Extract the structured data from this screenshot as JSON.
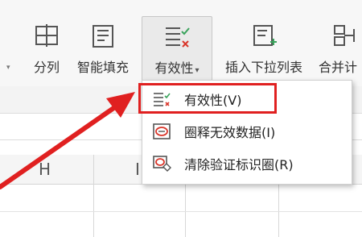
{
  "ribbon": {
    "buttons": [
      {
        "label": "分列",
        "icon": "split-columns-icon"
      },
      {
        "label": "智能填充",
        "icon": "smart-fill-icon"
      },
      {
        "label": "有效性",
        "icon": "data-validation-icon",
        "dropdown_arrow": "▾"
      },
      {
        "label": "插入下拉列表",
        "icon": "insert-dropdown-list-icon"
      },
      {
        "label": "合并计",
        "icon": "merge-calc-icon"
      }
    ],
    "tick": "▾"
  },
  "sheet": {
    "columns": [
      "H",
      "I"
    ]
  },
  "menu": {
    "items": [
      {
        "label": "有效性(V)",
        "icon": "validation-list-icon"
      },
      {
        "label": "圈释无效数据(I)",
        "icon": "circle-invalid-icon"
      },
      {
        "label": "清除验证标识圈(R)",
        "icon": "clear-circle-icon"
      }
    ]
  },
  "colors": {
    "highlight": "#e02020",
    "icon_green": "#3aa35c",
    "icon_red": "#d9362b"
  }
}
